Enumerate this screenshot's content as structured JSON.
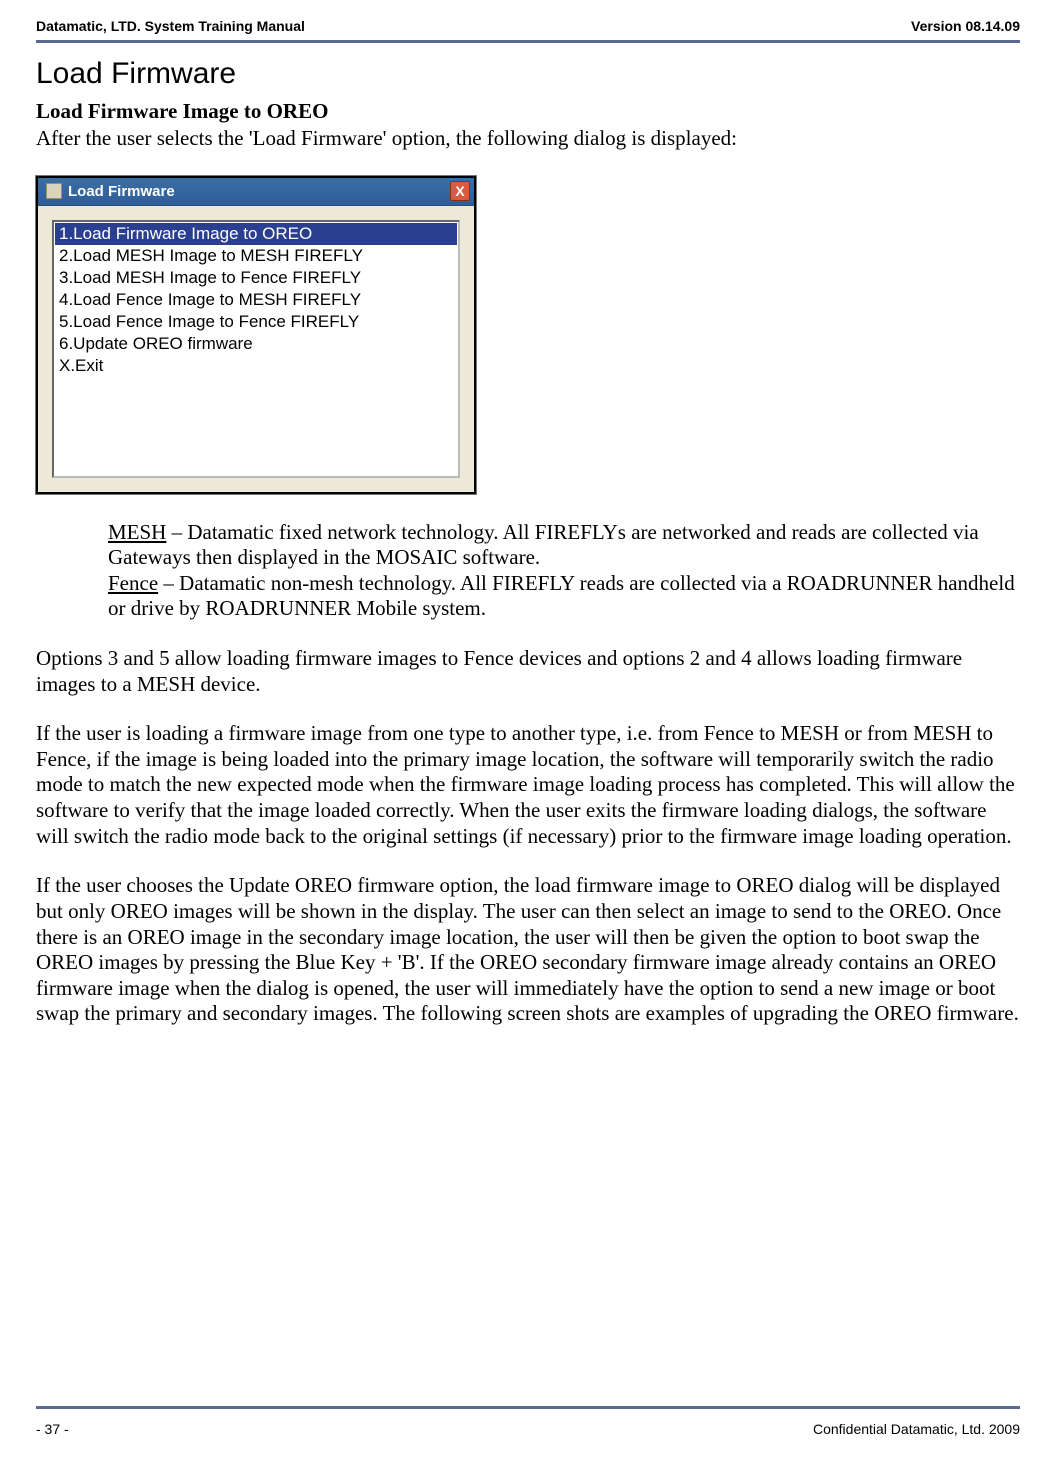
{
  "header": {
    "left": "Datamatic, LTD. System Training  Manual",
    "right": "Version 08.14.09"
  },
  "section_title": "Load Firmware",
  "sub_title": "Load Firmware Image to OREO",
  "intro": "After the user selects the 'Load Firmware' option, the following dialog is displayed:",
  "dialog": {
    "title": "Load Firmware",
    "close_glyph": "X",
    "items": [
      "1.Load Firmware Image to OREO",
      "2.Load MESH Image to MESH FIREFLY",
      "3.Load MESH Image to Fence FIREFLY",
      "4.Load Fence Image to MESH FIREFLY",
      "5.Load Fence Image to Fence FIREFLY",
      "6.Update OREO firmware",
      "X.Exit"
    ]
  },
  "definitions": {
    "mesh_term": "MESH",
    "mesh_text": " – Datamatic fixed network technology.  All FIREFLYs are networked and reads are collected via Gateways then displayed in the MOSAIC software.",
    "fence_term": "Fence",
    "fence_text": " – Datamatic non-mesh technology.  All FIREFLY reads are collected via a ROADRUNNER handheld or drive by ROADRUNNER Mobile system."
  },
  "paragraphs": [
    "Options 3 and 5 allow loading firmware images to Fence devices and options 2 and 4 allows loading firmware images to a MESH device.",
    "If the user is loading a firmware image from one type to another type, i.e. from Fence to MESH or from MESH to Fence, if the image is being loaded into the primary image location, the software will temporarily switch the radio mode to match the new expected mode when the firmware image loading process has completed.  This will allow the software to verify that the image loaded correctly.  When the user exits the firmware loading dialogs, the software will switch the radio mode back to the original settings (if necessary) prior to the firmware image loading operation.",
    "If the user chooses the Update OREO firmware option, the load firmware image to OREO dialog will be displayed but only OREO images will be shown in the display. The user can then select an image to send to the OREO.  Once there is an OREO image in the secondary image location, the user will then be given the option to boot swap the OREO images by pressing the Blue Key + 'B'.  If the OREO secondary firmware image already contains an OREO firmware image when the dialog is opened, the user will immediately have the option to send a new image or boot swap the primary and secondary images.  The following screen shots are examples of upgrading the OREO firmware."
  ],
  "footer": {
    "left": "- 37 -",
    "right": "Confidential Datamatic, Ltd. 2009"
  }
}
